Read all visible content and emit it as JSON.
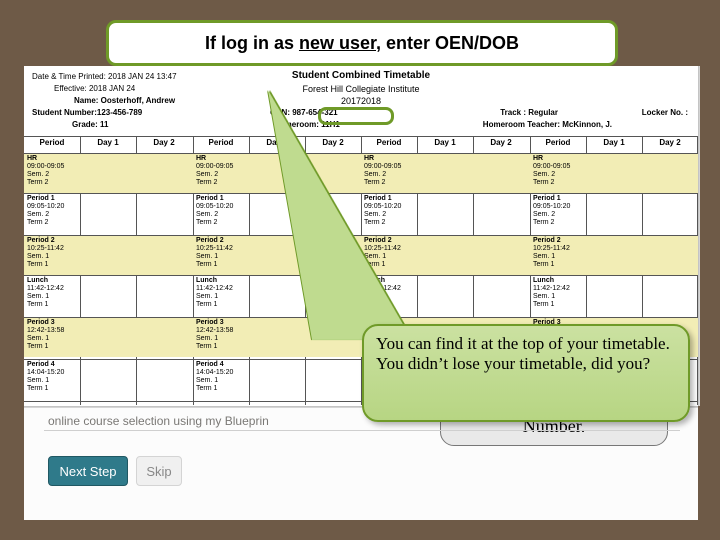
{
  "banner": {
    "prefix": "If log in as ",
    "underlined": "new user",
    "suffix": ", enter OEN/DOB"
  },
  "timetable": {
    "title": "Student Combined Timetable",
    "school": "Forest Hill Collegiate Institute",
    "schoolyear": "20172018",
    "date_printed": "Date & Time Printed: 2018 JAN 24  13:47",
    "effective": "Effective: 2018 JAN 24",
    "name_line": "Name: Oosterhoff, Andrew",
    "student_no": "Student Number:123-456-789",
    "grade": "Grade: 11",
    "oen": "OEN: 987-654-321",
    "homeroom": "Homeroom: 11H1",
    "track": "Track : Regular",
    "hr_teacher": "Homeroom Teacher: McKinnon, J.",
    "locker": "Locker No. :",
    "col_headers": [
      "Period",
      "Day 1",
      "Day 2",
      "Period",
      "Day 1",
      "Day 2",
      "Period",
      "Day 1",
      "Day 2",
      "Period",
      "Day 1",
      "Day 2"
    ],
    "rows": [
      {
        "name": "HR",
        "time": "09:00-09:05",
        "sub": "Sem. 2",
        "sub2": "Term 2"
      },
      {
        "name": "Period 1",
        "time": "09:05-10:20",
        "sub": "Sem. 2",
        "sub2": "Term 2"
      },
      {
        "name": "Period 2",
        "time": "10:25-11:42",
        "sub": "Sem. 1",
        "sub2": "Term 1"
      },
      {
        "name": "Lunch",
        "time": "11:42-12:42",
        "sub": "Sem. 1",
        "sub2": "Term 1"
      },
      {
        "name": "Period 3",
        "time": "12:42-13:58",
        "sub": "Sem. 1",
        "sub2": "Term 1"
      },
      {
        "name": "Period 4",
        "time": "14:04-15:20",
        "sub": "Sem. 1",
        "sub2": "Term 1"
      }
    ]
  },
  "bubble": {
    "main": "You can find it at the top of your timetable. You didn’t lose your timetable, did you?",
    "behind": "Number."
  },
  "footer": {
    "line": "online course selection using my Blueprin",
    "next": "Next Step",
    "skip": "Skip"
  }
}
